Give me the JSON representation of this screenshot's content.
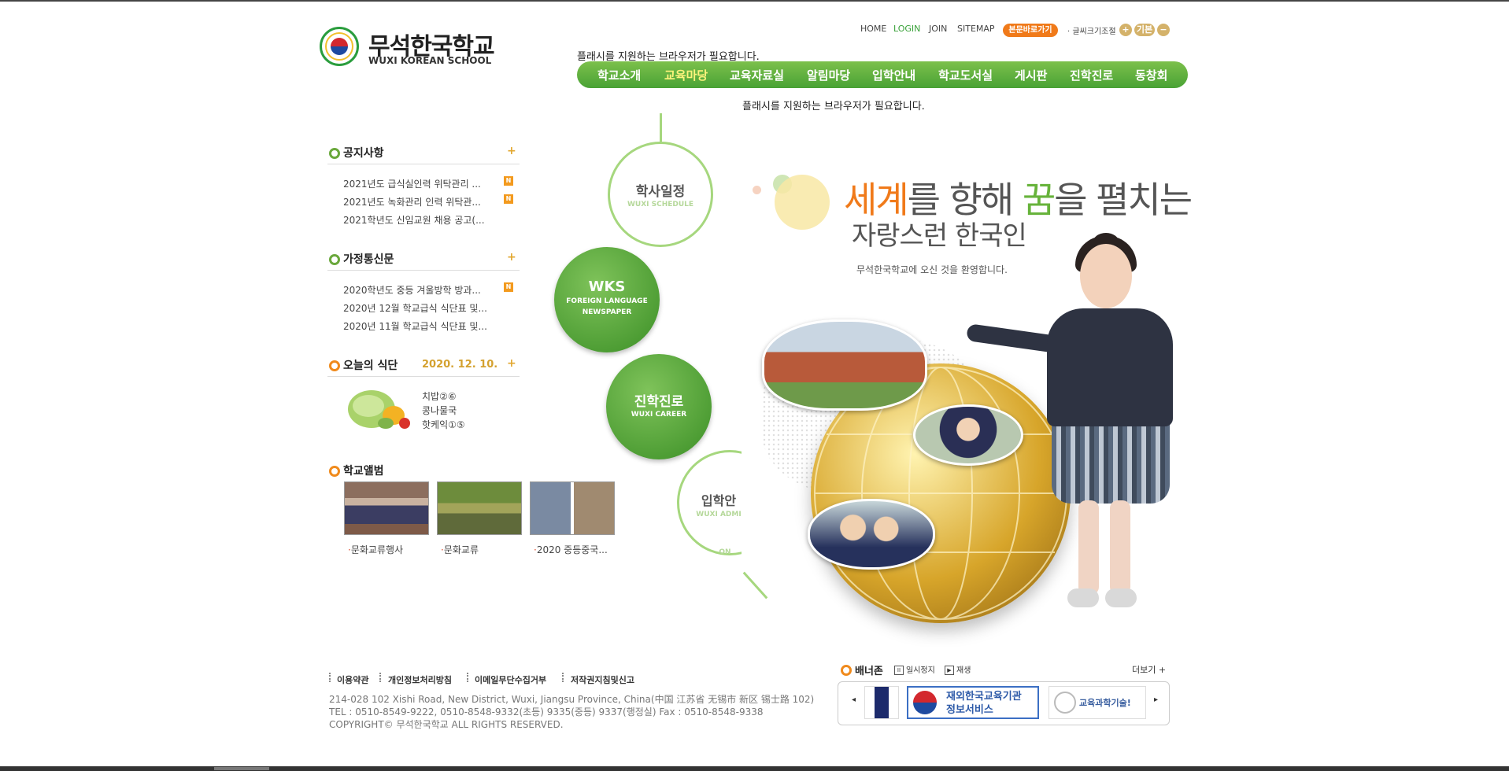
{
  "site": {
    "name_kr": "무석한국학교",
    "name_en": "WUXI KOREAN SCHOOL"
  },
  "util_nav": {
    "home": "HOME",
    "login": "LOGIN",
    "join": "JOIN",
    "sitemap": "SITEMAP",
    "skip": "본문바로가기",
    "font_label": "· 글씨크기조절",
    "font_plus": "+",
    "font_default": "기본",
    "font_minus": "−"
  },
  "flash_notice": "플래시를 지원하는 브라우저가 필요합니다.",
  "gnb": [
    {
      "label": "학교소개"
    },
    {
      "label": "교육마당"
    },
    {
      "label": "교육자료실"
    },
    {
      "label": "알림마당"
    },
    {
      "label": "입학안내"
    },
    {
      "label": "학교도서실"
    },
    {
      "label": "게시판"
    },
    {
      "label": "진학진로"
    },
    {
      "label": "동창회"
    }
  ],
  "notice": {
    "title": "공지사항",
    "more": "+",
    "items": [
      {
        "text": "2021년도 급식실인력 위탁관리 ...",
        "badge": "N"
      },
      {
        "text": "2021년도 녹화관리 인력 위탁관...",
        "badge": "N"
      },
      {
        "text": "2021학년도 신임교원 채용 공고(..."
      }
    ]
  },
  "newsletter": {
    "title": "가정통신문",
    "more": "+",
    "items": [
      {
        "text": "2020학년도 중등 겨울방학 방과...",
        "badge": "N"
      },
      {
        "text": "2020년 12월 학교급식 식단표 및..."
      },
      {
        "text": "2020년 11월 학교급식 식단표 및..."
      }
    ]
  },
  "meal": {
    "title": "오늘의 식단",
    "date": "2020. 12. 10.",
    "more": "+",
    "menu": [
      "치밥②⑥",
      "콩나물국",
      "핫케익①⑤"
    ]
  },
  "album": {
    "title": "학교앨범",
    "items": [
      {
        "caption": "문화교류행사"
      },
      {
        "caption": "문화교류"
      },
      {
        "caption": "2020 중등중국..."
      }
    ]
  },
  "quick_circles": {
    "schedule": {
      "title": "학사일정",
      "sub": "WUXI SCHEDULE"
    },
    "wks": {
      "title": "WKS",
      "sub1": "FOREIGN LANGUAGE",
      "sub2": "NEWSPAPER"
    },
    "career": {
      "title": "진학진로",
      "sub": "WUXI CAREER"
    },
    "admission": {
      "title": "입학안",
      "sub": "WUXI ADMI",
      "sub2": "ON"
    }
  },
  "hero": {
    "slogan_a": "세계",
    "slogan_b": "를 향해 ",
    "slogan_c": "꿈",
    "slogan_d": "을 펼치는",
    "slogan_line2": "자랑스런 한국인",
    "welcome": "무석한국학교에 오신 것을 환영합니다."
  },
  "footer": {
    "links": [
      "이용약관",
      "개인정보처리방침",
      "이메일무단수집거부",
      "저작권지침및신고"
    ],
    "address": "214-028 102 Xishi Road, New District, Wuxi, Jiangsu Province, China(中国 江苏省 无锡市 新区 锡士路 102)",
    "tel": "TEL : 0510-8549-9222, 0510-8548-9332(초등) 9335(중등) 9337(행정실) Fax : 0510-8548-9338",
    "copyright": "COPYRIGHT© 무석한국학교 ALL RIGHTS RESERVED."
  },
  "banner_zone": {
    "title": "배너존",
    "pause": "일시정지",
    "play": "재생",
    "more": "더보기 +",
    "prev": "◂",
    "next": "▸",
    "banner2_line1": "재외한국교육기관",
    "banner2_line2": "정보서비스",
    "banner3": "교육과학기술!"
  }
}
